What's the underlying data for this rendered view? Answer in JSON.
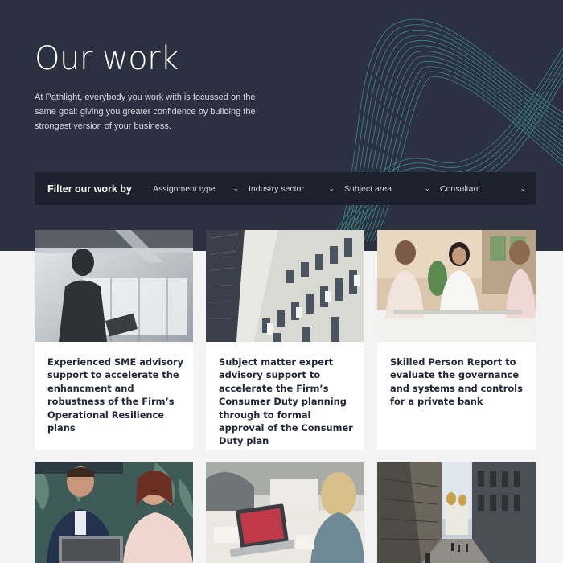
{
  "hero": {
    "title": "Our work",
    "description": "At Pathlight, everybody you work with is focussed on the same goal: giving you greater confidence by building the strongest version of your business."
  },
  "filter": {
    "label": "Filter our work by",
    "options": [
      {
        "label": "Assignment type"
      },
      {
        "label": "Industry sector"
      },
      {
        "label": "Subject area"
      },
      {
        "label": "Consultant"
      }
    ]
  },
  "cards": [
    {
      "title": "Experienced SME advisory support to accelerate the enhancment and robustness of the Firm’s Operational Resilience plans",
      "image": "silhouette-office-photo"
    },
    {
      "title": "Subject matter expert advisory support to accelerate the Firm’s Consumer Duty planning through to formal approval of the Consumer Duty plan",
      "image": "building-facade-photo"
    },
    {
      "title": "Skilled Person Report to evaluate the governance and systems and controls for a private bank",
      "image": "women-meeting-photo"
    },
    {
      "title": "",
      "image": "colleagues-laptop-photo"
    },
    {
      "title": "",
      "image": "laptop-meeting-photo"
    },
    {
      "title": "",
      "image": "city-street-photo"
    }
  ],
  "colors": {
    "hero_bg": "#2c3142",
    "filter_bg": "#1d212d",
    "accent_lines": "#3f9a8f",
    "page_bg": "#f3f3f3",
    "card_text": "#23273a"
  }
}
